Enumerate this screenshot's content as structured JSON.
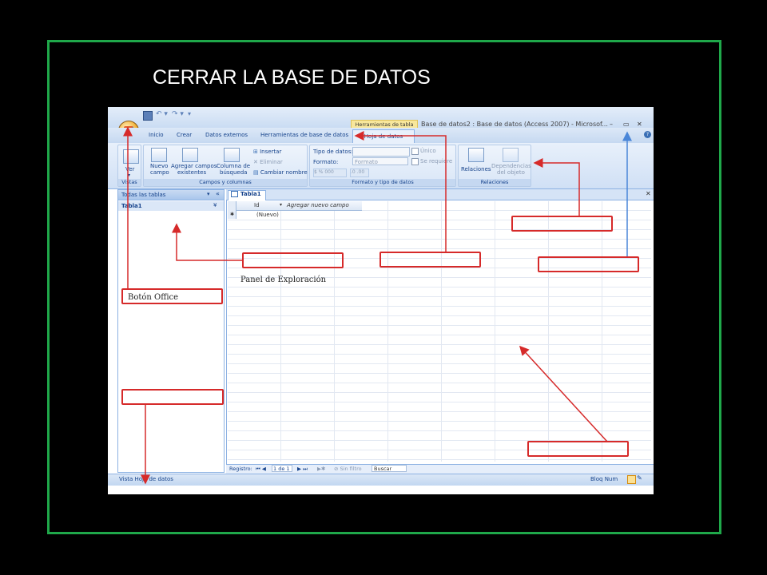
{
  "slide": {
    "title": "CERRAR LA BASE DE DATOS",
    "frame_color": "#1fa84a"
  },
  "window": {
    "title": "Base de datos2 : Base de datos (Access 2007) - Microsof...",
    "context_tool_header": "Herramientas de tabla",
    "controls": [
      "–",
      "▭",
      "✕"
    ]
  },
  "ribbon": {
    "tabs": [
      "Inicio",
      "Crear",
      "Datos externos",
      "Herramientas de base de datos"
    ],
    "active_tab": "Hoja de datos",
    "groups": {
      "vistas": {
        "label": "Vistas",
        "ver": "Ver"
      },
      "campos": {
        "label": "Campos y columnas",
        "nuevo_campo_1": "Nuevo",
        "nuevo_campo_2": "campo",
        "agregar_1": "Agregar campos",
        "agregar_2": "existentes",
        "columna_1": "Columna de",
        "columna_2": "búsqueda",
        "insertar": "Insertar",
        "eliminar": "Eliminar",
        "cambiar_nombre": "Cambiar nombre"
      },
      "formato": {
        "label": "Formato y tipo de datos",
        "tipo_datos": "Tipo de datos:",
        "formato": "Formato:",
        "formato_value": "Formato",
        "unico": "Único",
        "se_requiere": "Se requiere"
      },
      "relaciones": {
        "label": "Relaciones",
        "relaciones_btn": "Relaciones",
        "dependencias_1": "Dependencias",
        "dependencias_2": "del objeto"
      }
    }
  },
  "nav_pane": {
    "header": "Todas las tablas",
    "group": "Tabla1"
  },
  "document": {
    "tab": "Tabla1",
    "columns": [
      "Id",
      "Agregar nuevo campo"
    ],
    "new_row": "(Nuevo)"
  },
  "record_nav": {
    "label": "Registro:",
    "position": "1 de 1",
    "filter": "Sin filtro",
    "search": "Buscar"
  },
  "status": {
    "left": "Vista Hoja de datos",
    "right": "Bloq Num"
  },
  "callouts": {
    "panel": "Panel de Exploración",
    "office": "Botón Office"
  },
  "colors": {
    "callout_red": "#d62a2a",
    "arrow_blue": "#4a86d8"
  }
}
